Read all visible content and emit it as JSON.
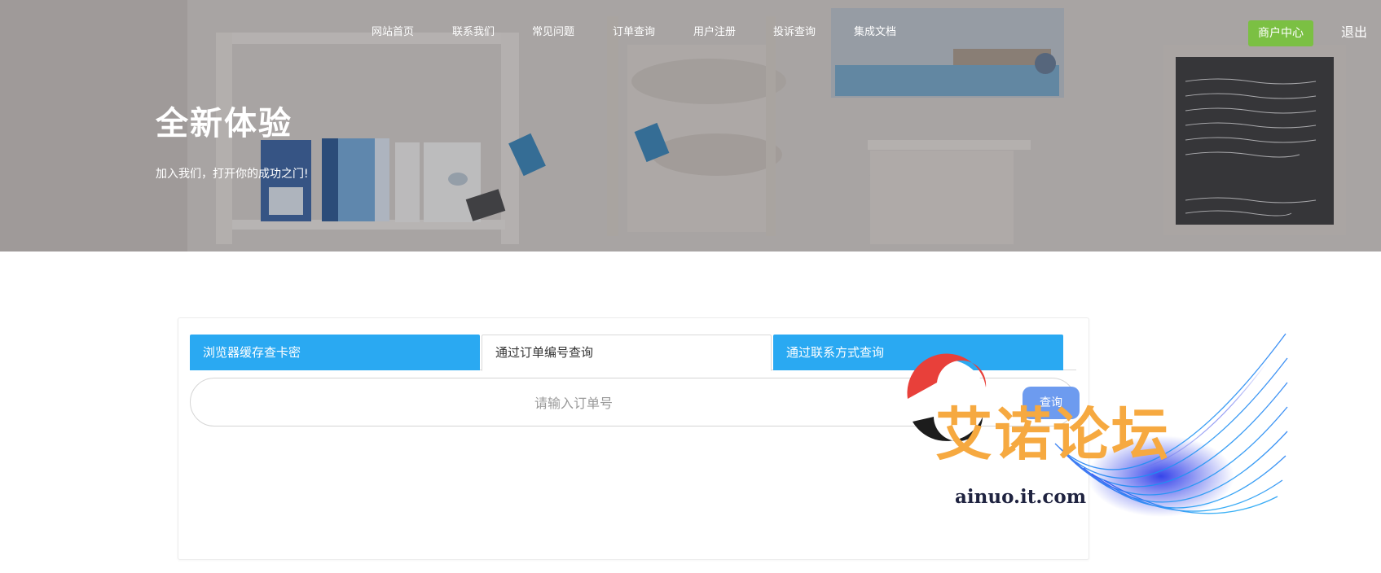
{
  "nav": {
    "items": [
      {
        "label": "网站首页"
      },
      {
        "label": "联系我们"
      },
      {
        "label": "常见问题"
      },
      {
        "label": "订单查询"
      },
      {
        "label": "用户注册"
      },
      {
        "label": "投诉查询"
      },
      {
        "label": "集成文档"
      }
    ],
    "merchant_button": "商户中心",
    "logout": "退出"
  },
  "hero": {
    "title": "全新体验",
    "subtitle": "加入我们，打开你的成功之门!"
  },
  "query": {
    "tabs": [
      {
        "label": "浏览器缓存查卡密",
        "active": false
      },
      {
        "label": "通过订单编号查询",
        "active": true
      },
      {
        "label": "通过联系方式查询",
        "active": false
      }
    ],
    "placeholder": "请输入订单号",
    "button": "查询"
  },
  "watermark": {
    "text": "艾诺论坛",
    "url": "ainuo.it.com"
  },
  "colors": {
    "accent_blue": "#2aa9f2",
    "merchant_green": "#7bc043",
    "search_button": "#6d9bef",
    "watermark_orange": "#f6a940"
  }
}
